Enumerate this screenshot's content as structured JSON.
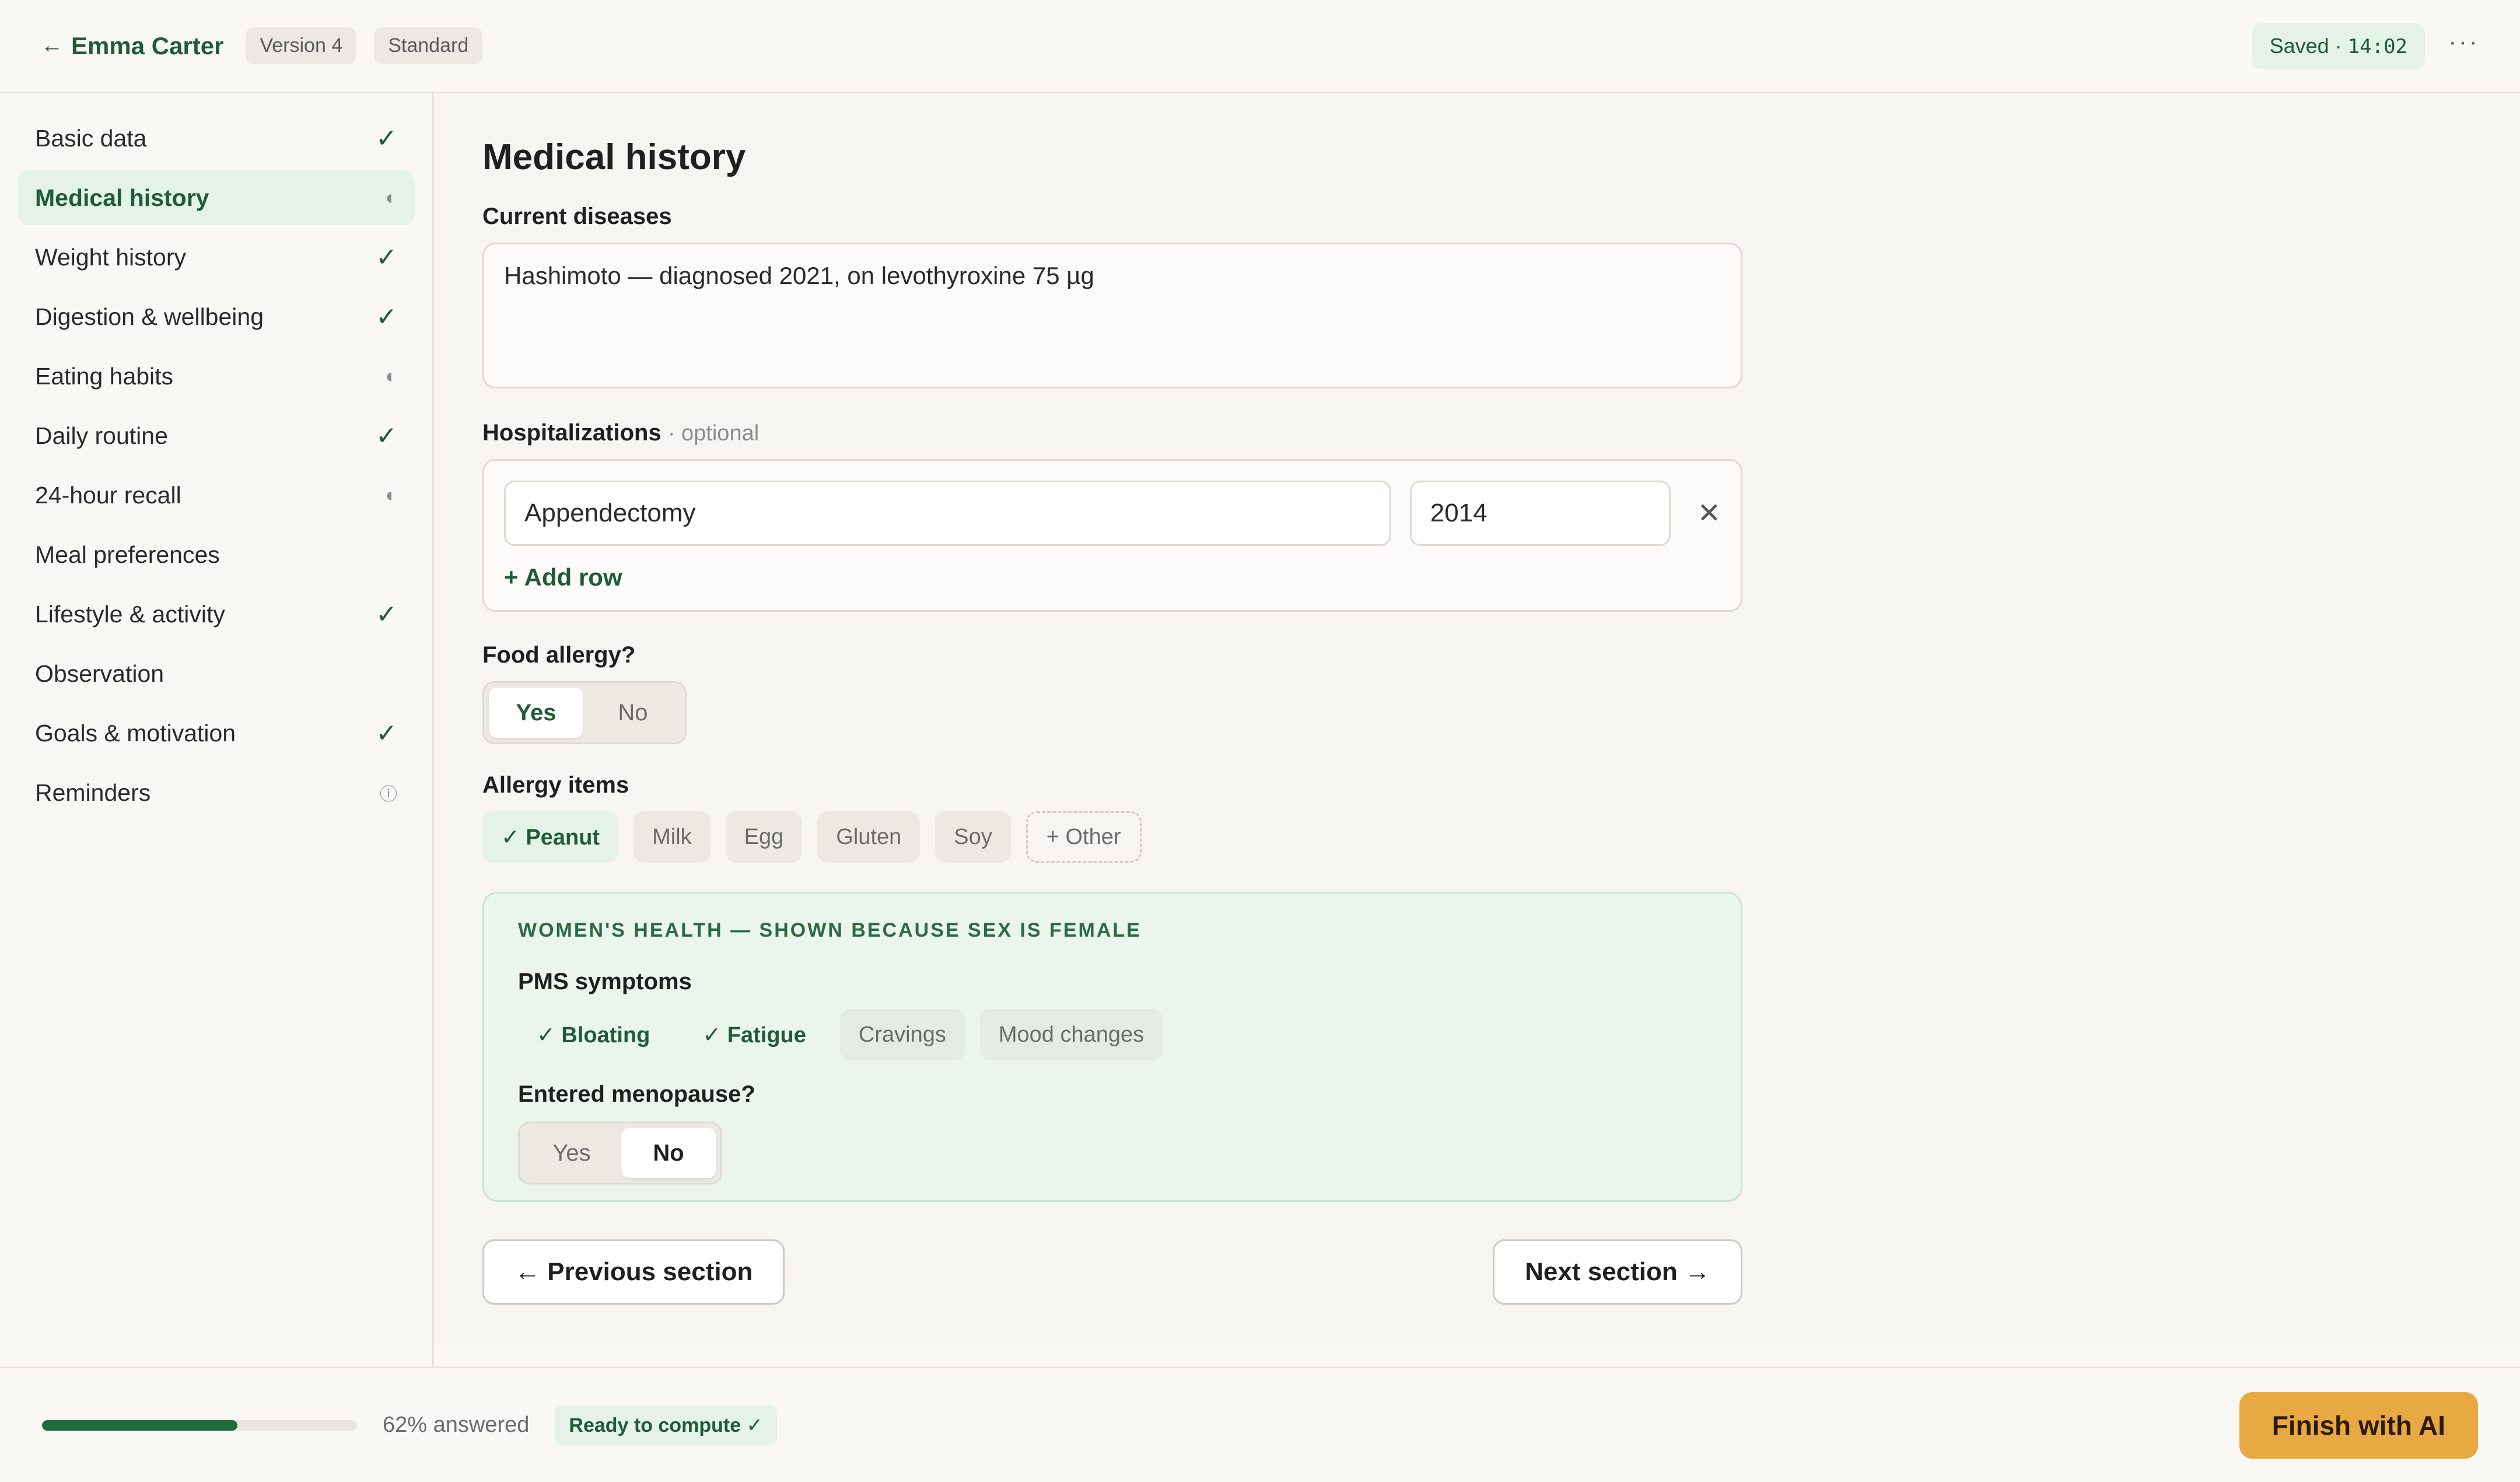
{
  "header": {
    "back_arrow": "←",
    "client_name": "Emma Carter",
    "version": "Version 4",
    "plan": "Standard",
    "saved_label": "Saved ·",
    "saved_time": "14:02",
    "more": "···"
  },
  "sidebar": {
    "items": [
      {
        "label": "Basic data",
        "status": "✓"
      },
      {
        "label": "Medical history",
        "status": "◐"
      },
      {
        "label": "Weight history",
        "status": "✓"
      },
      {
        "label": "Digestion & wellbeing",
        "status": "✓"
      },
      {
        "label": "Eating habits",
        "status": "◐"
      },
      {
        "label": "Daily routine",
        "status": "✓"
      },
      {
        "label": "24-hour recall",
        "status": "◐"
      },
      {
        "label": "Meal preferences",
        "status": ""
      },
      {
        "label": "Lifestyle & activity",
        "status": "✓"
      },
      {
        "label": "Observation",
        "status": ""
      },
      {
        "label": "Goals & motivation",
        "status": "✓"
      },
      {
        "label": "Reminders",
        "status": "ⓘ"
      }
    ]
  },
  "main": {
    "title": "Medical history",
    "current_diseases": {
      "label": "Current diseases",
      "value": "Hashimoto — diagnosed 2021, on levothyroxine 75 µg"
    },
    "hospitalizations": {
      "label": "Hospitalizations",
      "optional": "· optional",
      "rows": [
        {
          "name": "Appendectomy",
          "year": "2014"
        }
      ],
      "remove_icon": "✕",
      "add_row": "+ Add row"
    },
    "food_allergy": {
      "label": "Food allergy?",
      "yes": "Yes",
      "no": "No",
      "selected": "Yes"
    },
    "allergy_items": {
      "label": "Allergy items",
      "items": [
        {
          "label": "✓ Peanut",
          "selected": true
        },
        {
          "label": "Milk",
          "selected": false
        },
        {
          "label": "Egg",
          "selected": false
        },
        {
          "label": "Gluten",
          "selected": false
        },
        {
          "label": "Soy",
          "selected": false
        }
      ],
      "other": "+ Other"
    },
    "womens_health": {
      "title": "WOMEN'S HEALTH — SHOWN BECAUSE SEX IS FEMALE",
      "pms_label": "PMS symptoms",
      "pms_items": [
        {
          "label": "✓ Bloating",
          "selected": true
        },
        {
          "label": "✓ Fatigue",
          "selected": true
        },
        {
          "label": "Cravings",
          "selected": false
        },
        {
          "label": "Mood changes",
          "selected": false
        }
      ],
      "menopause_label": "Entered menopause?",
      "yes": "Yes",
      "no": "No",
      "selected": "No"
    },
    "prev_button": "← Previous section",
    "next_button": "Next section →"
  },
  "footer": {
    "progress_fraction": 0.62,
    "progress_text": "62% answered",
    "ready_badge": "Ready to compute ✓",
    "finish_button": "Finish with AI"
  },
  "colors": {
    "accent_green": "#1f5c36",
    "accent_bg": "#e5f2e7",
    "finish_orange": "#e8a842"
  }
}
